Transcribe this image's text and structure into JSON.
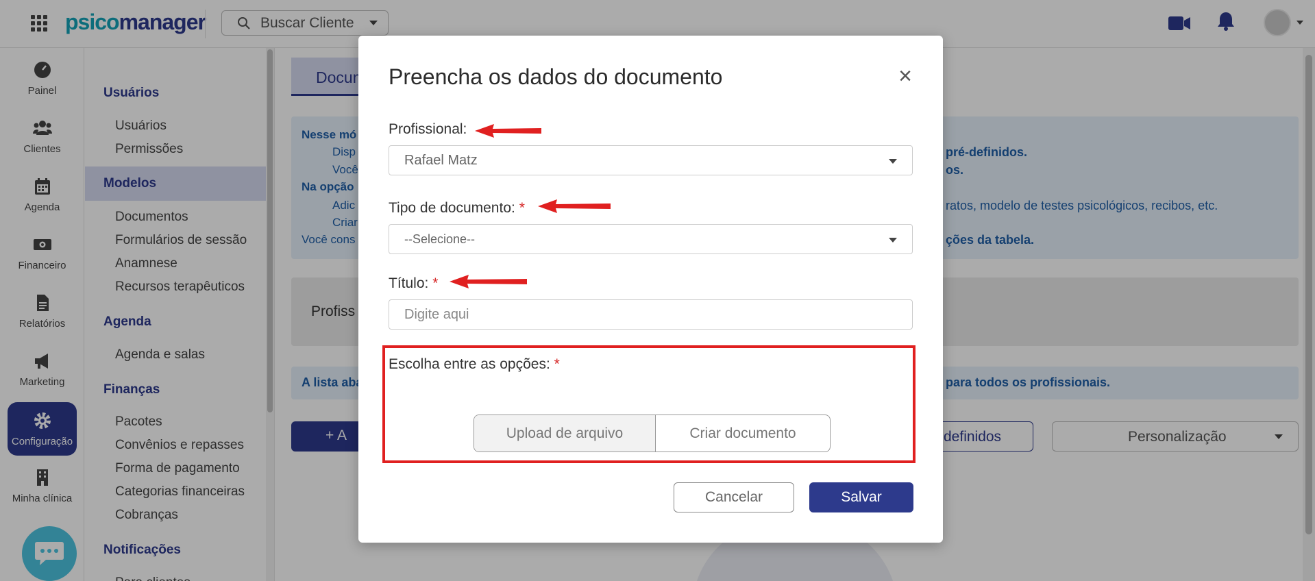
{
  "brand": {
    "part1": "psico",
    "part2": "manager"
  },
  "search": {
    "label": "Buscar Cliente"
  },
  "rail": [
    {
      "label": "Painel"
    },
    {
      "label": "Clientes"
    },
    {
      "label": "Agenda"
    },
    {
      "label": "Financeiro"
    },
    {
      "label": "Relatórios"
    },
    {
      "label": "Marketing"
    },
    {
      "label": "Configuração"
    },
    {
      "label": "Minha clínica"
    }
  ],
  "menu": {
    "sections": [
      {
        "title": "Usuários",
        "links": [
          "Usuários",
          "Permissões"
        ]
      },
      {
        "title": "Modelos",
        "links": [
          "Documentos",
          "Formulários de sessão",
          "Anamnese",
          "Recursos terapêuticos"
        ]
      },
      {
        "title": "Agenda",
        "links": [
          "Agenda e salas"
        ]
      },
      {
        "title": "Finanças",
        "links": [
          "Pacotes",
          "Convênios e repasses",
          "Forma de pagamento",
          "Categorias financeiras",
          "Cobranças"
        ]
      },
      {
        "title": "Notificações",
        "links": [
          "Para clientes"
        ]
      }
    ]
  },
  "main": {
    "tab": "Docum",
    "info_left": [
      "Nesse mó",
      "Disp",
      "Você",
      "Na opção",
      "Adic",
      "Criar",
      "Você cons"
    ],
    "info_right": [
      "pré-definidos.",
      "os.",
      "ratos, modelo de testes psicológicos, recibos, etc.",
      "ções da tabela."
    ],
    "filter_label": "Profiss",
    "notice_left": "A lista aba",
    "notice_right": "para todos os profissionais.",
    "add_button": "+ A",
    "predef_button": "definidos",
    "pers_button": "Personalização"
  },
  "modal": {
    "title": "Preencha os dados do documento",
    "close": "×",
    "professional": {
      "label": "Profissional:",
      "value": "Rafael Matz"
    },
    "doc_type": {
      "label": "Tipo de documento:",
      "required": "*",
      "value": "--Selecione--"
    },
    "title_field": {
      "label": "Título:",
      "required": "*",
      "placeholder": "Digite aqui"
    },
    "options": {
      "label": "Escolha entre as opções:",
      "required": "*",
      "choices": [
        "Upload de arquivo",
        "Criar documento"
      ]
    },
    "cancel": "Cancelar",
    "save": "Salvar"
  },
  "colors": {
    "brand_primary": "#2d3a8c",
    "brand_accent": "#14a3b8",
    "annotation_red": "#e02020"
  }
}
